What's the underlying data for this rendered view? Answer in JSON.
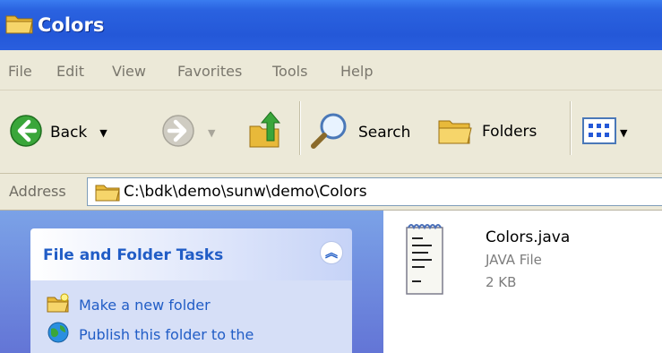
{
  "window": {
    "title": "Colors"
  },
  "menu": [
    "File",
    "Edit",
    "View",
    "Favorites",
    "Tools",
    "Help"
  ],
  "toolbar": {
    "back_label": "Back",
    "search_label": "Search",
    "folders_label": "Folders"
  },
  "address": {
    "label": "Address",
    "path": "C:\\bdk\\demo\\sunw\\demo\\Colors"
  },
  "tasks_panel": {
    "title": "File and Folder Tasks",
    "items": [
      "Make a new folder",
      "Publish this folder to the"
    ]
  },
  "files": [
    {
      "name": "Colors.java",
      "type": "JAVA File",
      "size": "2 KB",
      "icon": "text-document-icon"
    }
  ],
  "colors": {
    "title_bar": "#2458d8",
    "menu_bg": "#ece9d8",
    "task_link": "#215dc6",
    "task_pane": "#6f8fe0"
  }
}
